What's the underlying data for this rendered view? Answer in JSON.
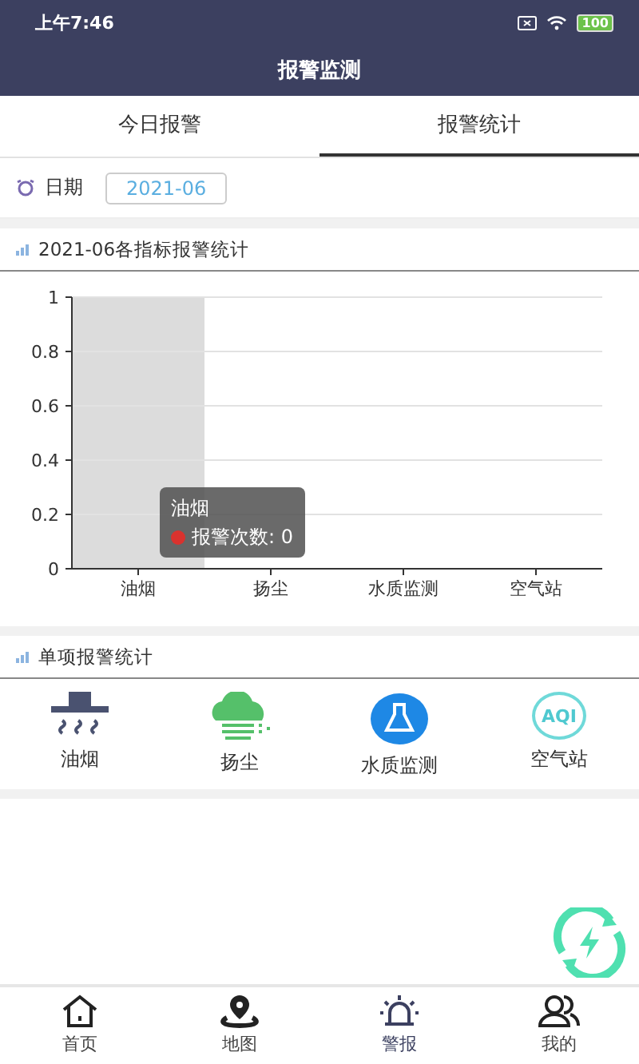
{
  "status_bar": {
    "time": "上午7:46",
    "battery": "100"
  },
  "header": {
    "title": "报警监测"
  },
  "tabs": [
    {
      "label": "今日报警",
      "selected": false
    },
    {
      "label": "报警统计",
      "selected": true
    }
  ],
  "date_filter": {
    "label": "日期",
    "value": "2021-06"
  },
  "overview": {
    "title": "2021-06各指标报警统计",
    "chart_data": {
      "type": "bar",
      "categories": [
        "油烟",
        "扬尘",
        "水质监测",
        "空气站"
      ],
      "series": [
        {
          "name": "报警次数",
          "color": "#d9322e",
          "values": [
            0,
            0,
            0,
            0
          ]
        }
      ],
      "ylim": [
        0,
        1
      ],
      "yticks": [
        0,
        0.2,
        0.4,
        0.6,
        0.8,
        1
      ],
      "grid": true
    },
    "tooltip": {
      "title": "油烟",
      "separator": ":",
      "value": "0"
    }
  },
  "single": {
    "title": "单项报警统计",
    "items": [
      {
        "kind": "hood",
        "label": "油烟"
      },
      {
        "kind": "dust",
        "label": "扬尘"
      },
      {
        "kind": "water",
        "label": "水质监测"
      },
      {
        "kind": "aqi",
        "label": "空气站",
        "icon_text": "AQI"
      }
    ]
  },
  "nav": [
    {
      "kind": "home",
      "label": "首页",
      "selected": false
    },
    {
      "kind": "map",
      "label": "地图",
      "selected": false
    },
    {
      "kind": "alarm",
      "label": "警报",
      "selected": true
    },
    {
      "kind": "people",
      "label": "我的",
      "selected": false
    }
  ]
}
